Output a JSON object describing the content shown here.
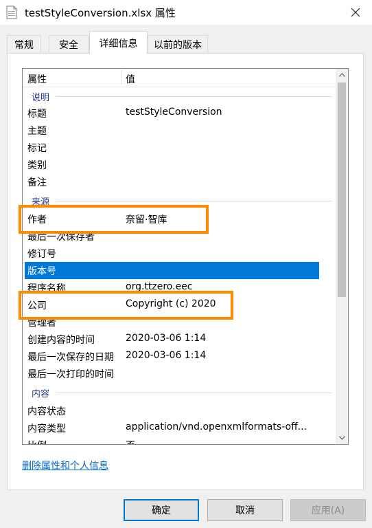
{
  "window": {
    "title": "testStyleConversion.xlsx 属性",
    "file_icon": "excel-file-icon",
    "close_icon": "close-icon"
  },
  "tabs": [
    {
      "label": "常规",
      "active": false
    },
    {
      "label": "安全",
      "active": false
    },
    {
      "label": "详细信息",
      "active": true
    },
    {
      "label": "以前的版本",
      "active": false
    }
  ],
  "list": {
    "header": {
      "property": "属性",
      "value": "值"
    },
    "groups": {
      "description": "说明",
      "origin": "来源",
      "content": "内容"
    },
    "rows": [
      {
        "key": "标题",
        "value": "testStyleConversion"
      },
      {
        "key": "主题",
        "value": ""
      },
      {
        "key": "标记",
        "value": ""
      },
      {
        "key": "类别",
        "value": ""
      },
      {
        "key": "备注",
        "value": ""
      },
      {
        "key": "作者",
        "value": "奈留·智库"
      },
      {
        "key": "最后一次保存者",
        "value": ""
      },
      {
        "key": "修订号",
        "value": ""
      },
      {
        "key": "版本号",
        "value": "",
        "selected": true
      },
      {
        "key": "程序名称",
        "value": "org.ttzero.eec"
      },
      {
        "key": "公司",
        "value": "Copyright (c) 2020"
      },
      {
        "key": "管理者",
        "value": ""
      },
      {
        "key": "创建内容的时间",
        "value": "2020-03-06 1:14"
      },
      {
        "key": "最后一次保存的日期",
        "value": "2020-03-06 1:14"
      },
      {
        "key": "最后一次打印的时间",
        "value": ""
      },
      {
        "key": "内容状态",
        "value": ""
      },
      {
        "key": "内容类型",
        "value": "application/vnd.openxmlformats-off..."
      },
      {
        "key": "比例",
        "value": "否"
      }
    ]
  },
  "link_text": "删除属性和个人信息",
  "buttons": {
    "ok": "确定",
    "cancel": "取消",
    "apply": "应用(A)"
  },
  "colors": {
    "selection": "#0078d7",
    "highlight_box": "#ff8c00",
    "group_label": "#1e3287",
    "link": "#0066cc"
  }
}
